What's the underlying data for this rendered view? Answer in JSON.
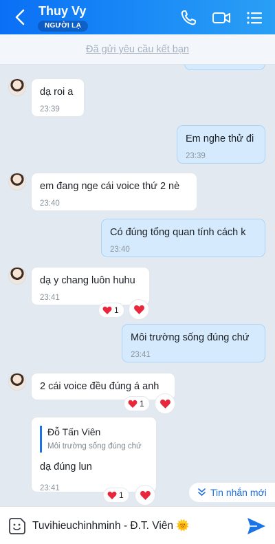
{
  "header": {
    "contact_name": "Thuy Vy",
    "stranger_badge": "NGƯỜI LẠ",
    "accent": "#0a6ff5"
  },
  "banner": {
    "text": "Đã gửi yêu cầu kết bạn"
  },
  "messages": [
    {
      "side": "in",
      "text": "dạ roi a",
      "time": "23:39"
    },
    {
      "side": "out",
      "text": "Em nghe thử đi",
      "time": "23:39"
    },
    {
      "side": "in",
      "text": "em đang nge cái voice thứ 2 nè",
      "time": "23:40"
    },
    {
      "side": "out",
      "text": "Có đúng tổng quan tính cách k",
      "time": "23:40"
    },
    {
      "side": "in",
      "text": "dạ y chang luôn huhu",
      "time": "23:41",
      "reaction_count": "1"
    },
    {
      "side": "out",
      "text": "Môi trường sống đúng chứ",
      "time": "23:41"
    },
    {
      "side": "in",
      "text": "2 cái voice đều đúng á anh",
      "reaction_count": "1"
    },
    {
      "side": "in",
      "quote_name": "Đỗ Tấn Viên",
      "quote_text": "Môi trường sống đúng chứ",
      "text": "dạ đúng lun",
      "time": "23:41",
      "reaction_count": "1"
    }
  ],
  "new_messages_label": "Tin nhắn mới",
  "input": {
    "value": "Tuvihieuchinhminh - Đ.T. Viên 🌞"
  }
}
